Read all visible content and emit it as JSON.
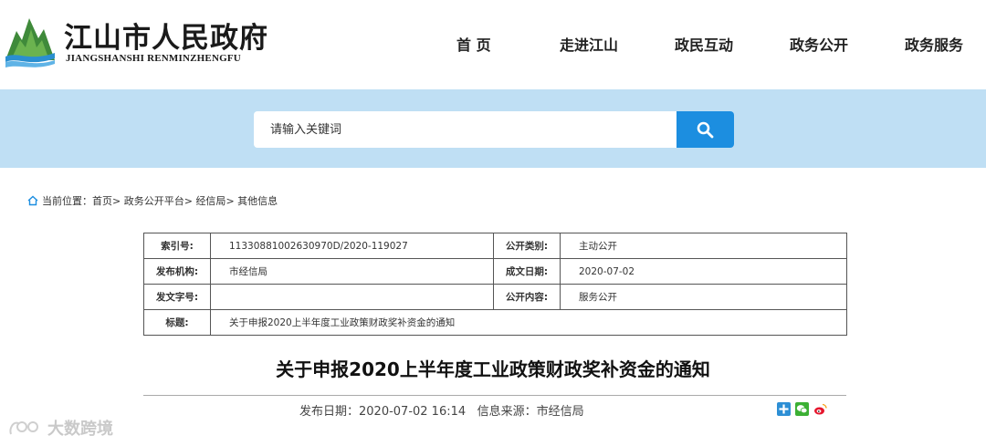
{
  "header": {
    "site_name": "江山市人民政府",
    "site_name_en": "JIANGSHANSHI RENMINZHENGFU",
    "logo_icon": "mountain-river-logo",
    "nav": [
      {
        "label": "首 页"
      },
      {
        "label": "走进江山"
      },
      {
        "label": "政民互动"
      },
      {
        "label": "政务公开"
      },
      {
        "label": "政务服务"
      }
    ]
  },
  "search": {
    "placeholder": "请输入关键词",
    "button_icon": "search-icon",
    "band_color": "#bfdff4",
    "button_color": "#1c8ee0"
  },
  "breadcrumb": {
    "prefix": "当前位置：",
    "items": [
      {
        "label": "首页"
      },
      {
        "label": "政务公开平台"
      },
      {
        "label": "经信局"
      },
      {
        "label": "其他信息"
      }
    ],
    "separator": ">"
  },
  "info": {
    "index_label": "索引号:",
    "index_value": "11330881002630970D/2020-119027",
    "category_label": "公开类别:",
    "category_value": "主动公开",
    "org_label": "发布机构:",
    "org_value": "市经信局",
    "date_label": "成文日期:",
    "date_value": "2020-07-02",
    "docno_label": "发文字号:",
    "docno_value": "",
    "content_label": "公开内容:",
    "content_value": "服务公开",
    "title_label": "标题:",
    "title_value": "关于申报2020上半年度工业政策财政奖补资金的通知"
  },
  "article": {
    "title": "关于申报2020上半年度工业政策财政奖补资金的通知",
    "publish_date": "发布日期：2020-07-02 16:14",
    "source": "信息来源：市经信局",
    "share_icons": [
      "share-plus-icon",
      "wechat-icon",
      "weibo-icon"
    ]
  },
  "watermark": {
    "text": "大数跨境"
  }
}
